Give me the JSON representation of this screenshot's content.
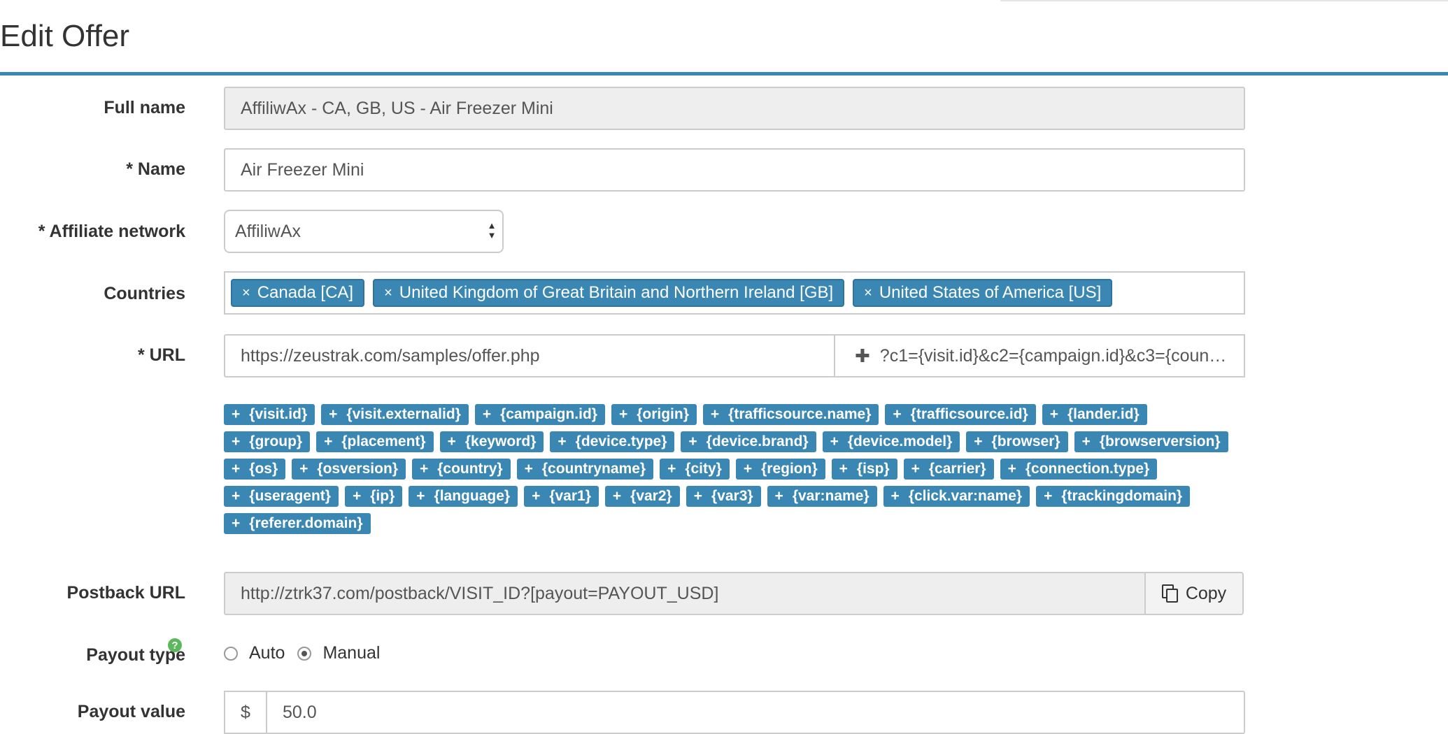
{
  "page": {
    "title": "Edit Offer"
  },
  "form": {
    "full_name": {
      "label": "Full name",
      "value": "AffiliwAx - CA, GB, US - Air Freezer Mini"
    },
    "name": {
      "label": "* Name",
      "value": "Air Freezer Mini"
    },
    "affiliate_network": {
      "label": "* Affiliate network",
      "value": "AffiliwAx"
    },
    "countries": {
      "label": "Countries",
      "items": [
        "Canada [CA]",
        "United Kingdom of Great Britain and Northern Ireland [GB]",
        "United States of America [US]"
      ],
      "remove_glyph": "×"
    },
    "url": {
      "label": "* URL",
      "value": "https://zeustrak.com/samples/offer.php",
      "params": "?c1={visit.id}&c2={campaign.id}&c3={count…",
      "add_glyph": "✚"
    },
    "tokens": {
      "plus": "+",
      "lines": [
        [
          "{visit.id}",
          "{visit.externalid}",
          "{campaign.id}",
          "{origin}",
          "{trafficsource.name}",
          "{trafficsource.id}",
          "{lander.id}"
        ],
        [
          "{group}",
          "{placement}",
          "{keyword}",
          "{device.type}",
          "{device.brand}",
          "{device.model}",
          "{browser}",
          "{browserversion}"
        ],
        [
          "{os}",
          "{osversion}",
          "{country}",
          "{countryname}",
          "{city}",
          "{region}",
          "{isp}",
          "{carrier}",
          "{connection.type}"
        ],
        [
          "{useragent}",
          "{ip}",
          "{language}",
          "{var1}",
          "{var2}",
          "{var3}",
          "{var:name}",
          "{click.var:name}",
          "{trackingdomain}"
        ],
        [
          "{referer.domain}"
        ]
      ]
    },
    "postback_url": {
      "label": "Postback URL",
      "value": "http://ztrk37.com/postback/VISIT_ID?[payout=PAYOUT_USD]",
      "copy_label": "Copy"
    },
    "payout_type": {
      "label": "Payout type",
      "help_glyph": "?",
      "options": [
        "Auto",
        "Manual"
      ],
      "selected": "Manual"
    },
    "payout_value": {
      "label": "Payout value",
      "currency": "$",
      "value": "50.0"
    }
  },
  "colors": {
    "accent": "#3a87b3",
    "help": "#5cb85c"
  },
  "icons": {
    "copy": "copy-icon",
    "help": "help-icon",
    "select": "select-arrows-icon",
    "remove": "close-icon",
    "add": "plus-icon"
  }
}
